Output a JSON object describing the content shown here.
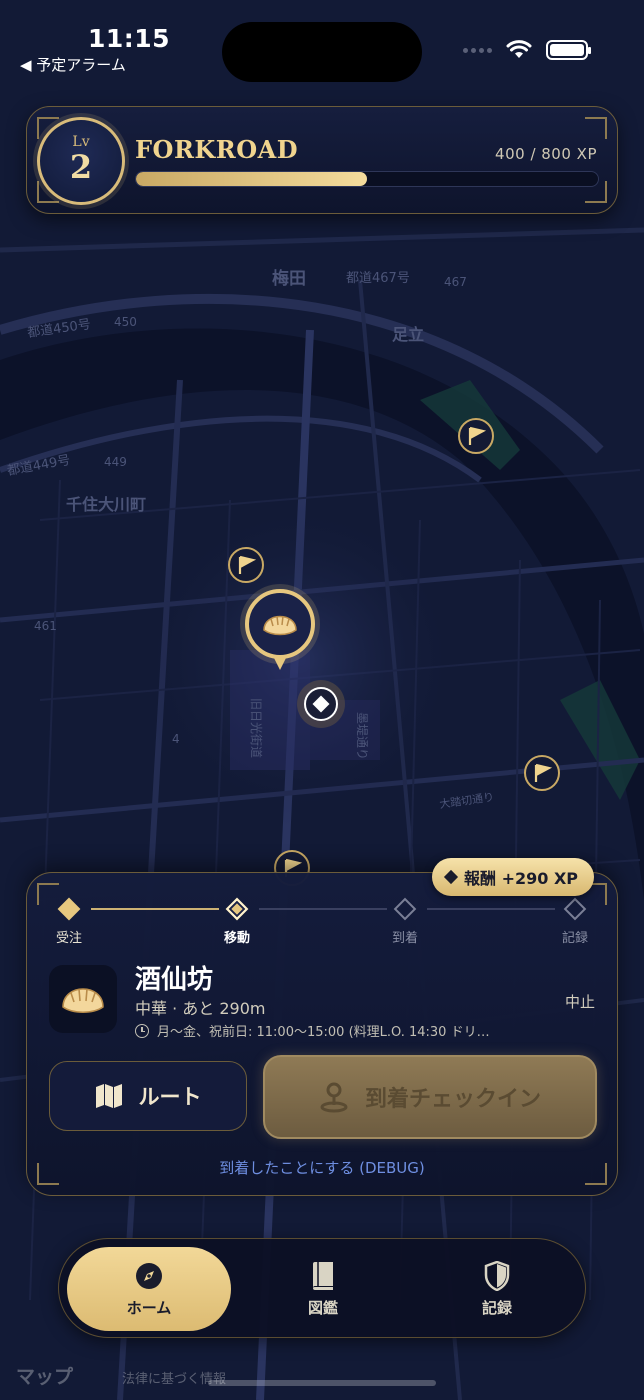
{
  "status_bar": {
    "time": "11:15",
    "back_label": "◀ 予定アラーム"
  },
  "header": {
    "level_label": "Lv",
    "level": "2",
    "brand": "FORKROAD",
    "xp_text": "400 / 800 XP",
    "xp_progress": 0.5
  },
  "map_labels": [
    {
      "text": "梅田"
    },
    {
      "text": "都道467号"
    },
    {
      "text": "467"
    },
    {
      "text": "都道450号"
    },
    {
      "text": "450"
    },
    {
      "text": "足立"
    },
    {
      "text": "都道449号"
    },
    {
      "text": "449"
    },
    {
      "text": "千住大川町"
    },
    {
      "text": "461"
    },
    {
      "text": "旧日光街道"
    },
    {
      "text": "墨堤通り"
    },
    {
      "text": "4"
    },
    {
      "text": "大踏切通り"
    }
  ],
  "quest": {
    "reward": "報酬 +290 XP",
    "steps": [
      {
        "label": "受注",
        "state": "done"
      },
      {
        "label": "移動",
        "state": "active"
      },
      {
        "label": "到着",
        "state": "todo"
      },
      {
        "label": "記録",
        "state": "todo"
      }
    ],
    "shop_name": "酒仙坊",
    "shop_meta": "中華 · あと 290m",
    "shop_hours": "月～金、祝前日: 11:00～15:00 (料理L.O. 14:30 ドリ…",
    "stop_label": "中止",
    "route_label": "ルート",
    "checkin_label": "到着チェックイン",
    "debug_label": "到着したことにする (DEBUG)"
  },
  "tabs": [
    {
      "label": "ホーム",
      "icon": "compass-icon",
      "active": true
    },
    {
      "label": "図鑑",
      "icon": "book-icon",
      "active": false
    },
    {
      "label": "記録",
      "icon": "shield-icon",
      "active": false
    }
  ],
  "footer": {
    "maps_label": "マップ",
    "legal_label": "法律に基づく情報"
  },
  "colors": {
    "accent_gold": "#e6c77f",
    "background_navy": "#0f1630",
    "debug_blue": "#6e8ee0"
  }
}
